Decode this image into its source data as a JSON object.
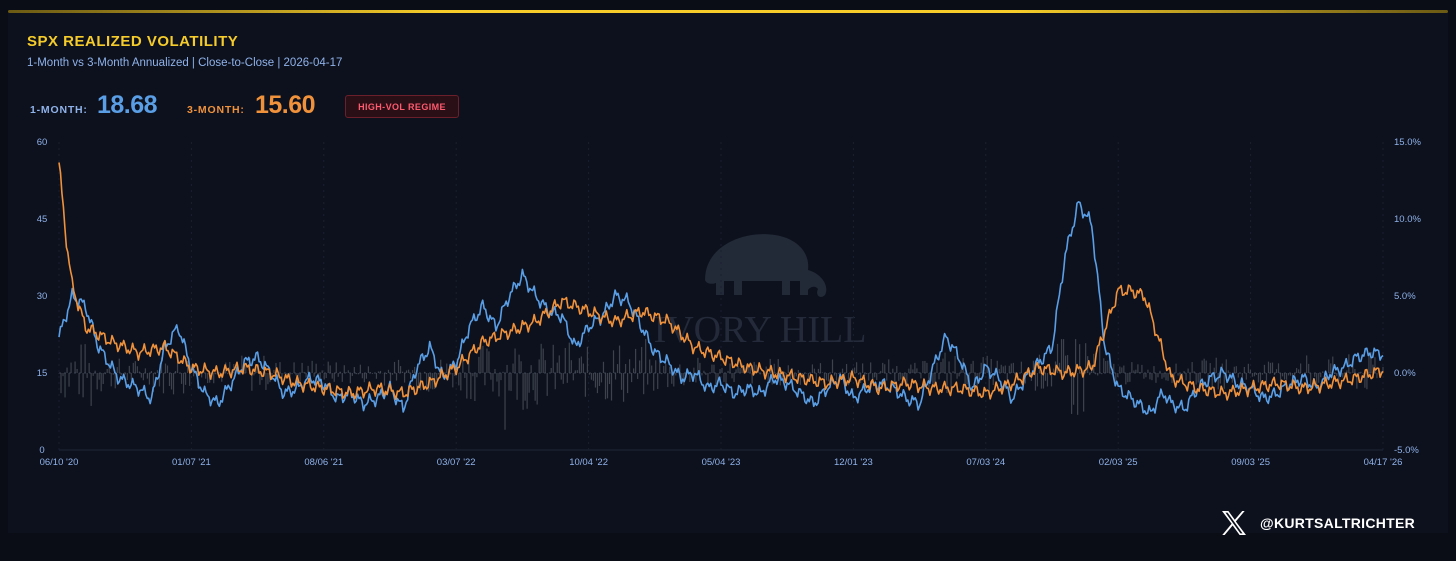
{
  "header": {
    "title": "SPX REALIZED VOLATILITY",
    "subtitle": "1-Month vs 3-Month Annualized | Close-to-Close | 2026-04-17"
  },
  "stats": {
    "one_month_label": "1-MONTH:",
    "one_month_value": "18.68",
    "three_month_label": "3-MONTH:",
    "three_month_value": "15.60",
    "regime_badge": "HIGH-VOL REGIME"
  },
  "watermark": {
    "text": "IVORY HILL"
  },
  "footer": {
    "handle": "@KURTSALTRICHTER",
    "social_icon": "x-logo-icon"
  },
  "colors": {
    "title": "#f5cc2a",
    "one_month": "#5a9fe6",
    "three_month": "#f0923c",
    "badge": "#ff5a6e"
  },
  "chart_data": {
    "type": "line",
    "x_tick_labels": [
      "06/10 '20",
      "01/07 '21",
      "08/06 '21",
      "03/07 '22",
      "10/04 '22",
      "05/04 '23",
      "12/01 '23",
      "07/03 '24",
      "02/03 '25",
      "09/03 '25",
      "04/17 '26"
    ],
    "y_left": {
      "ticks": [
        "0",
        "15",
        "30",
        "45",
        "60"
      ],
      "ylim": [
        0,
        60
      ]
    },
    "y_right": {
      "ticks": [
        "-5.0%",
        "0.0%",
        "5.0%",
        "10.0%",
        "15.0%"
      ],
      "ylim": [
        -5,
        15
      ]
    },
    "series": [
      {
        "axis": "left",
        "x": [
          0,
          0.01,
          0.02,
          0.03,
          0.045,
          0.06,
          0.07,
          0.08,
          0.09,
          0.1,
          0.11,
          0.12,
          0.13,
          0.14,
          0.15,
          0.16,
          0.17,
          0.18,
          0.19,
          0.2,
          0.21,
          0.22,
          0.23,
          0.24,
          0.25,
          0.26,
          0.27,
          0.28,
          0.29,
          0.3,
          0.31,
          0.32,
          0.33,
          0.34,
          0.35,
          0.36,
          0.37,
          0.38,
          0.39,
          0.4,
          0.41,
          0.42,
          0.43,
          0.44,
          0.45,
          0.46,
          0.47,
          0.48,
          0.49,
          0.5,
          0.51,
          0.52,
          0.53,
          0.54,
          0.55,
          0.56,
          0.57,
          0.58,
          0.59,
          0.6,
          0.61,
          0.62,
          0.63,
          0.64,
          0.65,
          0.66,
          0.67,
          0.68,
          0.69,
          0.7,
          0.71,
          0.72,
          0.73,
          0.74,
          0.75,
          0.76,
          0.77,
          0.78,
          0.79,
          0.8,
          0.81,
          0.815,
          0.82,
          0.825,
          0.83,
          0.835,
          0.84,
          0.85,
          0.86,
          0.87,
          0.88,
          0.89,
          0.9,
          0.91,
          0.92,
          0.93,
          0.94,
          0.95,
          0.96,
          0.97,
          0.98,
          0.99,
          1.0
        ],
        "values": [
          22,
          30,
          28,
          20,
          14,
          12,
          10,
          20,
          24,
          16,
          11,
          9,
          13,
          17,
          18,
          15,
          11,
          12,
          14,
          13,
          10,
          11,
          9,
          10,
          12,
          8,
          16,
          20,
          14,
          17,
          24,
          28,
          24,
          30,
          34,
          30,
          27,
          26,
          20,
          24,
          26,
          30,
          29,
          24,
          19,
          17,
          14,
          15,
          12,
          13,
          11,
          12,
          11,
          14,
          13,
          11,
          9,
          12,
          14,
          10,
          12,
          13,
          12,
          10,
          9,
          16,
          22,
          18,
          12,
          16,
          14,
          10,
          14,
          17,
          20,
          38,
          48,
          44,
          20,
          12,
          10,
          9,
          8,
          7,
          10,
          11,
          9,
          8,
          12,
          14,
          15,
          13,
          12,
          10,
          11,
          13,
          14,
          12,
          15,
          16,
          18,
          19,
          18.68
        ]
      },
      {
        "axis": "left",
        "x": [
          0,
          0.005,
          0.01,
          0.02,
          0.04,
          0.06,
          0.08,
          0.1,
          0.12,
          0.14,
          0.16,
          0.18,
          0.2,
          0.22,
          0.24,
          0.26,
          0.28,
          0.3,
          0.32,
          0.34,
          0.36,
          0.38,
          0.4,
          0.42,
          0.44,
          0.46,
          0.48,
          0.5,
          0.52,
          0.54,
          0.56,
          0.58,
          0.6,
          0.62,
          0.64,
          0.66,
          0.68,
          0.7,
          0.72,
          0.74,
          0.76,
          0.78,
          0.8,
          0.81,
          0.82,
          0.84,
          0.86,
          0.88,
          0.9,
          0.92,
          0.94,
          0.96,
          0.98,
          1.0
        ],
        "values": [
          56,
          42,
          32,
          24,
          21,
          19,
          20,
          16,
          15,
          16,
          15,
          13,
          12,
          11,
          12,
          11,
          13,
          16,
          21,
          23,
          25,
          29,
          27,
          25,
          27,
          25,
          20,
          18,
          16,
          15,
          14,
          13,
          14,
          12,
          13,
          12,
          12,
          11,
          13,
          16,
          15,
          16,
          31,
          31,
          30,
          14,
          12,
          11,
          12,
          13,
          12,
          13,
          14,
          15.6
        ]
      },
      {
        "axis": "right",
        "type": "bar",
        "values_range_pct": [
          -5,
          2.2
        ]
      }
    ]
  }
}
